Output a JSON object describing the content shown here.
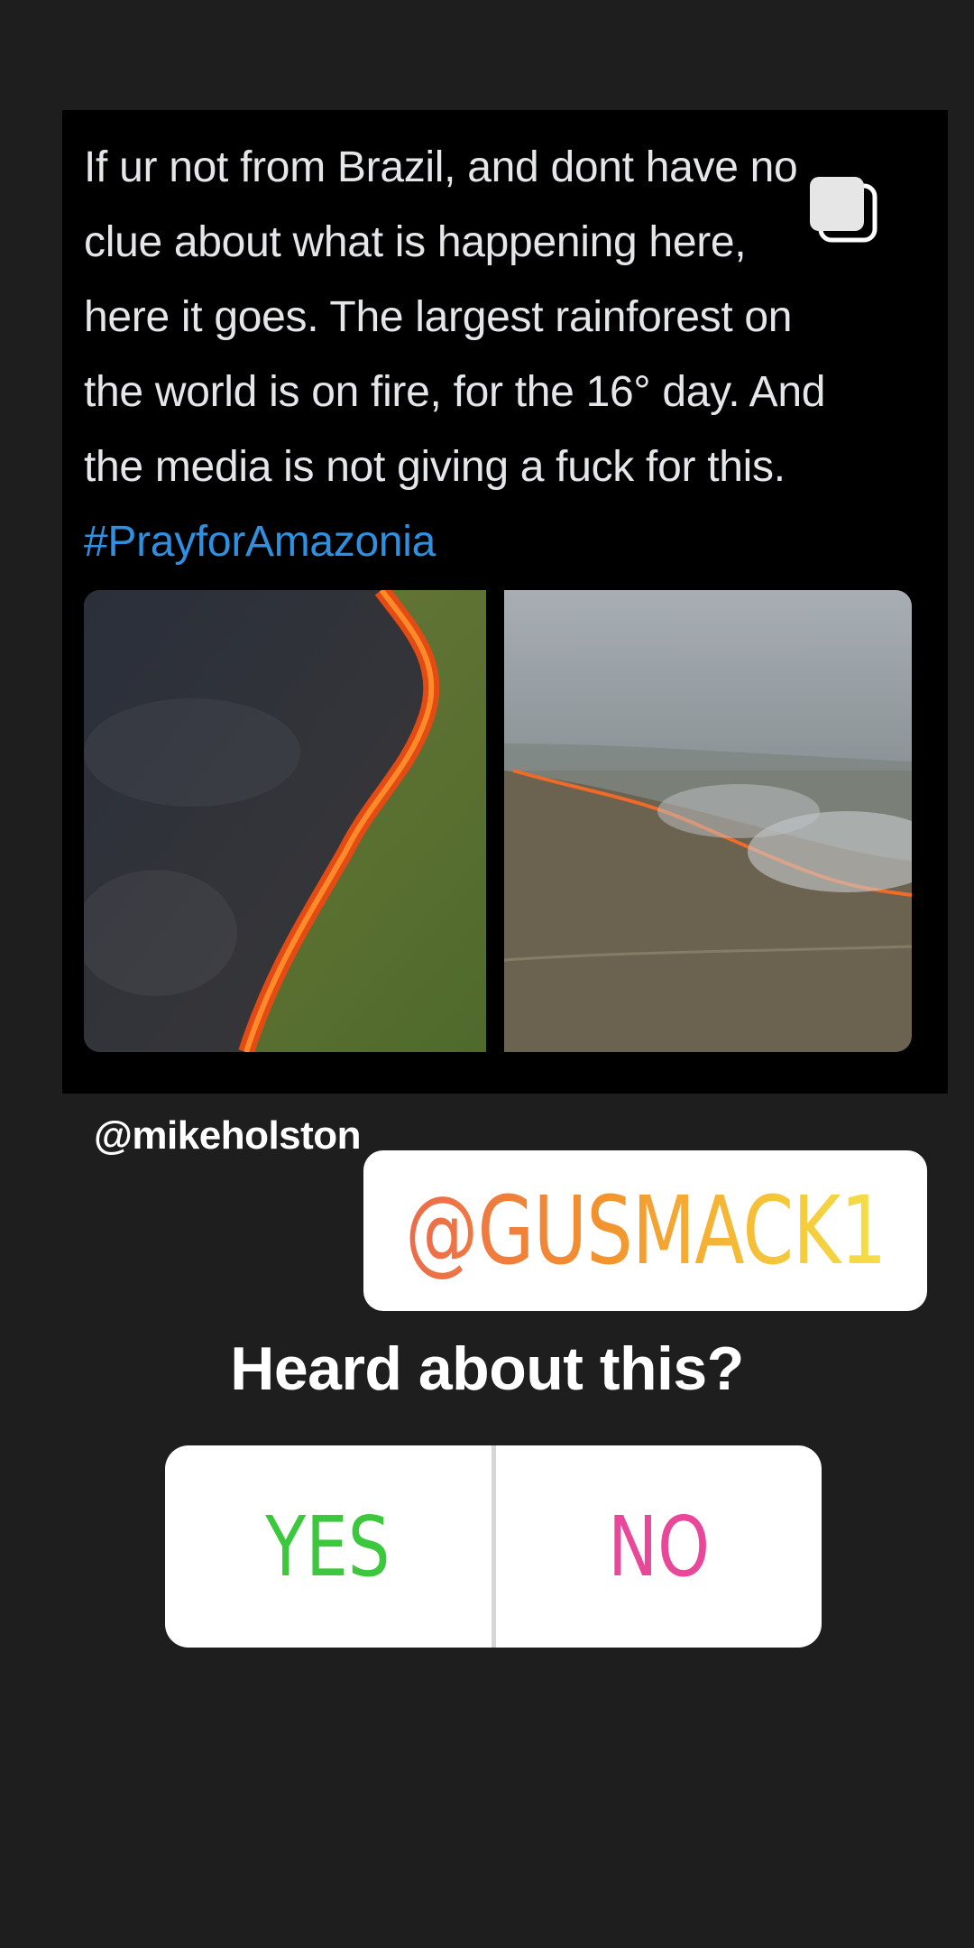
{
  "post": {
    "lines": [
      "If ur not from Brazil, and dont have no",
      "clue about what is happening here,",
      "here it goes. The largest rainforest on",
      "the world is on fire, for the 16° day. And",
      "the media is not giving a fuck for this."
    ],
    "hashtag": "#PrayforAmazonia",
    "multi_icon": "multiple-images-icon"
  },
  "mention_small": "@mikeholston",
  "mention_sticker": "@GUSMACK1",
  "poll": {
    "question": "Heard about this?",
    "yes_label": "YES",
    "no_label": "NO",
    "yes_color": "#3cc83c",
    "no_color": "#e8479a"
  }
}
